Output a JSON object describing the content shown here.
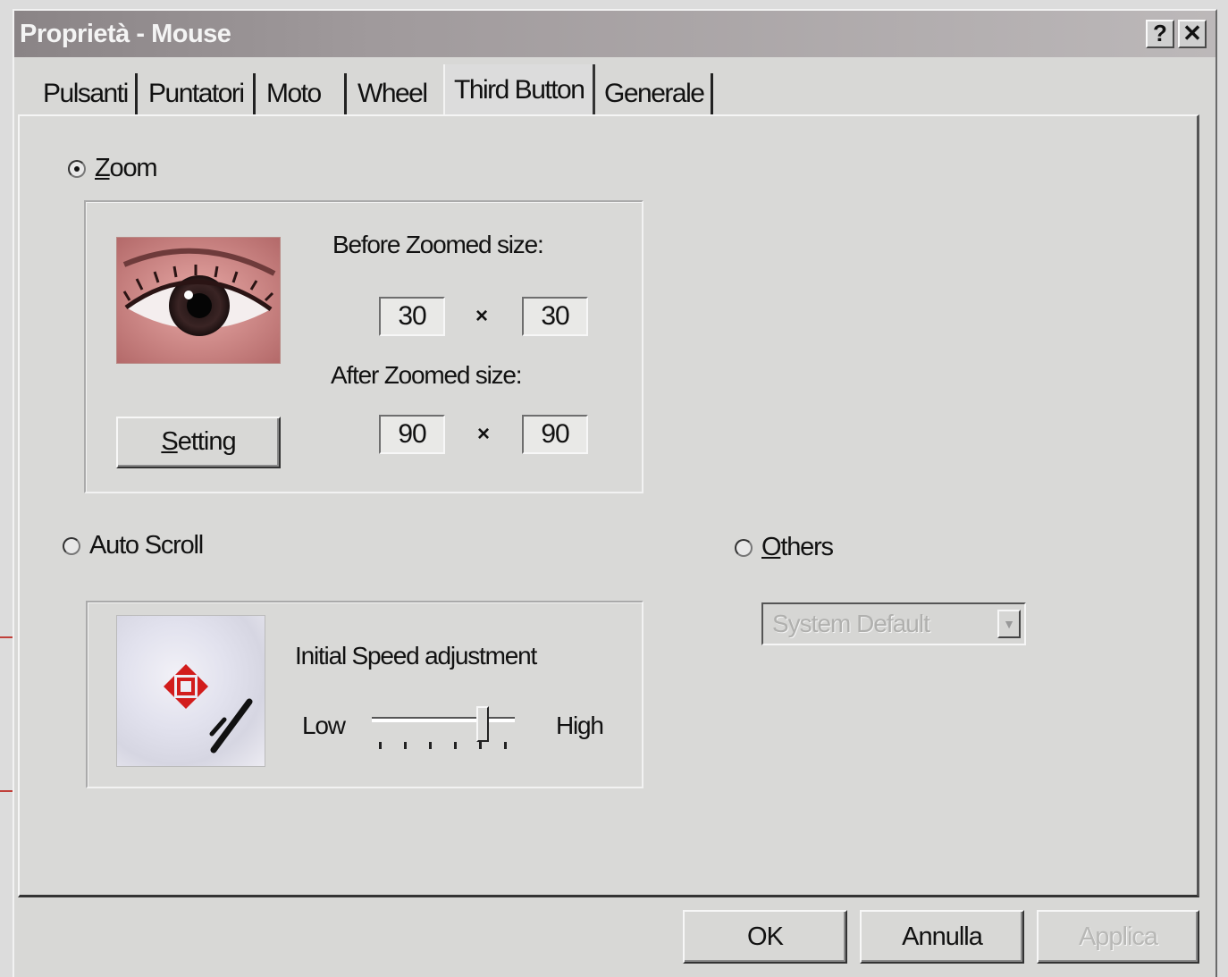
{
  "window": {
    "title": "Proprietà - Mouse",
    "help_button": "?",
    "close_button": "✕"
  },
  "tabs": [
    {
      "label": "Pulsanti",
      "active": false
    },
    {
      "label": "Puntatori",
      "active": false
    },
    {
      "label": "Moto",
      "active": false
    },
    {
      "label": "Wheel",
      "active": false
    },
    {
      "label": "Third Button",
      "active": true
    },
    {
      "label": "Generale",
      "active": false
    }
  ],
  "zoom": {
    "option_label_prefix": "Z",
    "option_label_rest": "oom",
    "selected": true,
    "before_label": "Before Zoomed size:",
    "before_w": "30",
    "before_h": "30",
    "after_label": "After Zoomed size:",
    "after_w": "90",
    "after_h": "90",
    "times_symbol": "×",
    "setting_prefix": "S",
    "setting_rest": "etting"
  },
  "auto_scroll": {
    "option_label": "Auto Scroll",
    "selected": false,
    "speed_label": "Initial Speed adjustment",
    "low_label": "Low",
    "high_label": "High",
    "slider_value": 0.8
  },
  "others": {
    "option_label_prefix": "O",
    "option_label_rest": "thers",
    "selected": false,
    "dropdown_value": "System Default",
    "dropdown_enabled": false
  },
  "footer": {
    "ok_label": "OK",
    "cancel_label": "Annulla",
    "apply_label": "Applica",
    "apply_enabled": false
  },
  "colors": {
    "titlebar": "#9a9496",
    "face": "#d8d8d6",
    "scroll_arrow": "#d21c1c"
  }
}
